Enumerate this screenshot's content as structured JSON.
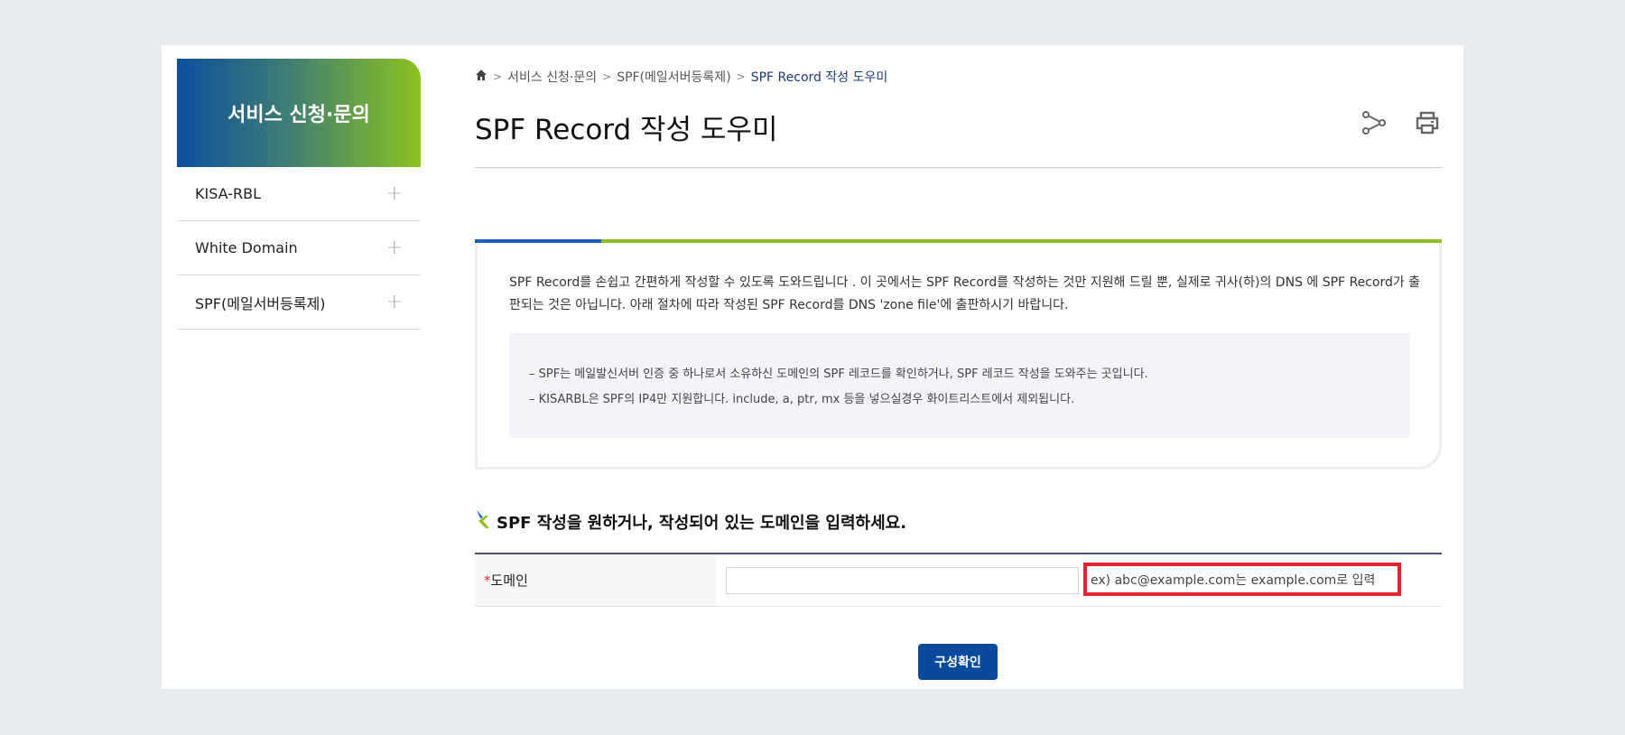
{
  "sidebar": {
    "title": "서비스 신청·문의",
    "items": [
      {
        "label": "KISA-RBL"
      },
      {
        "label": "White Domain"
      },
      {
        "label": "SPF(메일서버등록제)"
      }
    ]
  },
  "breadcrumb": {
    "items": [
      "서비스 신청·문의",
      "SPF(메일서버등록제)"
    ],
    "current": "SPF Record 작성 도우미"
  },
  "page": {
    "title": "SPF Record 작성 도우미"
  },
  "info": {
    "intro": "SPF Record를 손쉽고 간편하게 작성할 수 있도록 도와드립니다 . 이 곳에서는 SPF Record를 작성하는 것만 지원해 드릴 뿐, 실제로 귀사(하)의 DNS 에 SPF Record가 출판되는 것은 아닙니다. 아래 절차에 따라 작성된 SPF Record를 DNS 'zone file'에 출판하시기 바랍니다.",
    "notes": [
      "–  SPF는 메일발신서버 인증 중 하나로서 소유하신 도메인의 SPF 레코드를 확인하거나, SPF 레코드 작성을 도와주는 곳입니다.",
      "–  KISARBL은 SPF의 IP4만 지원합니다. include, a, ptr, mx 등을 넣으실경우 화이트리스트에서 제외됩니다."
    ]
  },
  "form": {
    "heading": "SPF 작성을 원하거나, 작성되어 있는 도메인을 입력하세요.",
    "required_mark": "*",
    "domain_label": "도메인",
    "domain_value": "",
    "hint": "ex) abc@example.com는 example.com로 입력",
    "submit": "구성확인"
  },
  "colors": {
    "brand_blue": "#0a4a9c",
    "brand_green": "#8cc21f",
    "highlight": "#e52330"
  }
}
